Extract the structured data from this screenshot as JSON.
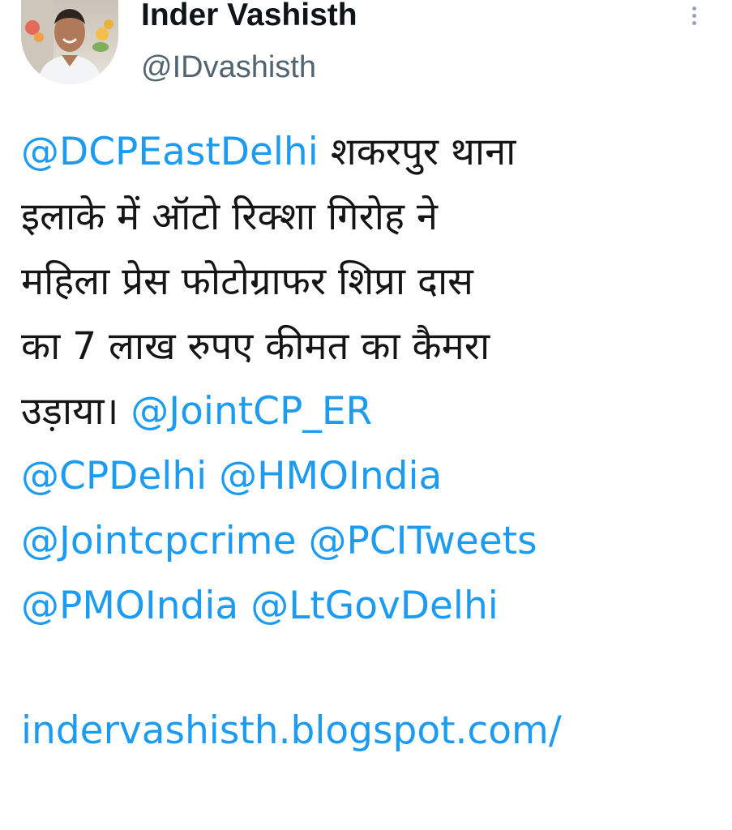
{
  "author": {
    "display_name": "Inder Vashisth",
    "handle": "@IDvashisth",
    "avatar_icon": "avatar-photo"
  },
  "more_icon": "vertical-ellipsis-icon",
  "colors": {
    "link": "#1d9bf0",
    "text": "#151515",
    "handle": "#536471"
  },
  "tweet": {
    "mention_dcp": "@DCPEastDelhi",
    "text_1": "शकरपुर थाना",
    "text_2": "इलाके में ऑटो रिक्शा गिरोह ने",
    "text_3": "महिला प्रेस फोटोग्राफर शिप्रा दास",
    "text_4": "का 7 लाख रुपए कीमत का कैमरा",
    "text_5": "उड़ाया।",
    "mention_jointcp": "@JointCP_ER",
    "mention_cp": "@CPDelhi",
    "mention_hmo": "@HMOIndia",
    "mention_jointcpcrime": "@Jointcpcrime",
    "mention_pci": "@PCITweets",
    "mention_pmo": "@PMOIndia",
    "mention_ltgov": "@LtGovDelhi",
    "link": "indervashisth.blogspot.com/"
  }
}
